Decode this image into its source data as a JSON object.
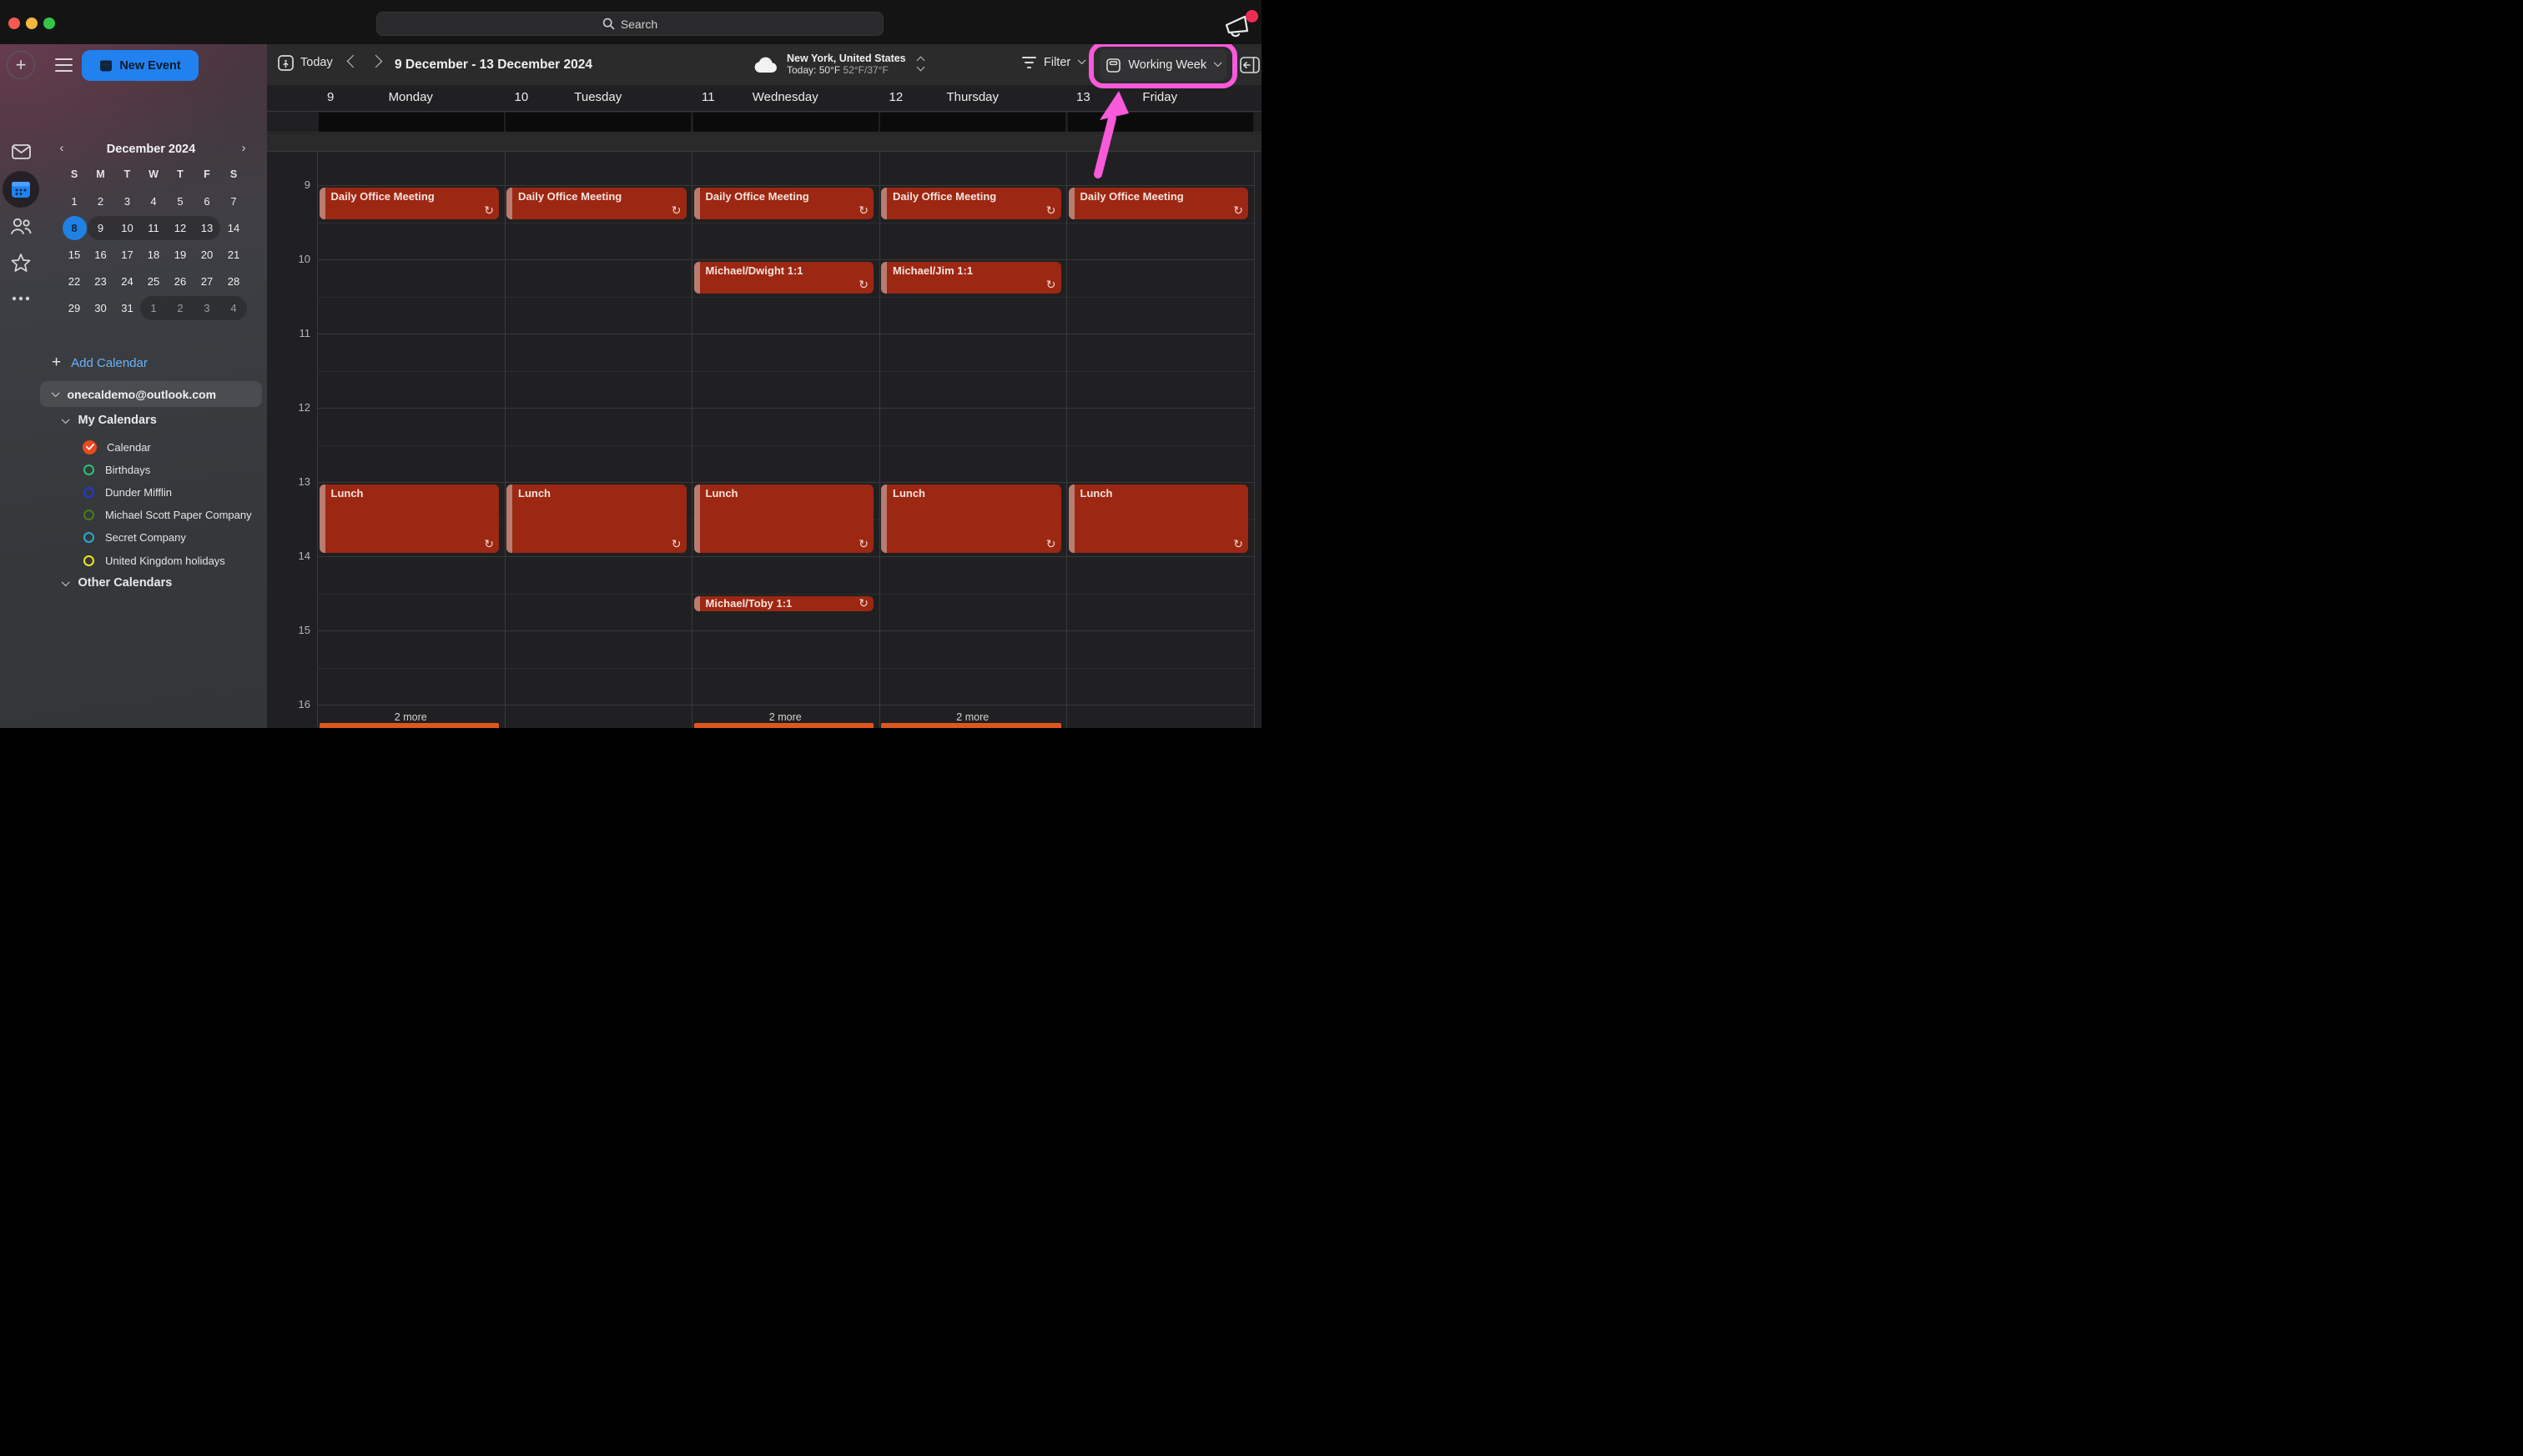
{
  "titlebar": {
    "search_placeholder": "Search"
  },
  "toolbar": {
    "new_event": "New Event",
    "today": "Today",
    "range_title": "9 December - 13 December 2024",
    "filter": "Filter",
    "view_mode": "Working Week"
  },
  "weather": {
    "location": "New York, United States",
    "today_label": "Today: 50°F",
    "hi_lo": "52°F/37°F"
  },
  "minicalendar": {
    "title": "December 2024",
    "weekdays": [
      "S",
      "M",
      "T",
      "W",
      "T",
      "F",
      "S"
    ],
    "weeks": [
      [
        {
          "d": "1"
        },
        {
          "d": "2"
        },
        {
          "d": "3"
        },
        {
          "d": "4"
        },
        {
          "d": "5"
        },
        {
          "d": "6"
        },
        {
          "d": "7"
        }
      ],
      [
        {
          "d": "8",
          "selected": true
        },
        {
          "d": "9"
        },
        {
          "d": "10"
        },
        {
          "d": "11"
        },
        {
          "d": "12"
        },
        {
          "d": "13"
        },
        {
          "d": "14"
        }
      ],
      [
        {
          "d": "15"
        },
        {
          "d": "16"
        },
        {
          "d": "17"
        },
        {
          "d": "18"
        },
        {
          "d": "19"
        },
        {
          "d": "20"
        },
        {
          "d": "21"
        }
      ],
      [
        {
          "d": "22"
        },
        {
          "d": "23"
        },
        {
          "d": "24"
        },
        {
          "d": "25"
        },
        {
          "d": "26"
        },
        {
          "d": "27"
        },
        {
          "d": "28"
        }
      ],
      [
        {
          "d": "29"
        },
        {
          "d": "30"
        },
        {
          "d": "31"
        },
        {
          "d": "1",
          "muted": true
        },
        {
          "d": "2",
          "muted": true
        },
        {
          "d": "3",
          "muted": true
        },
        {
          "d": "4",
          "muted": true
        }
      ]
    ],
    "pills": [
      {
        "week": 1,
        "from": 1,
        "to": 5
      },
      {
        "week": 4,
        "from": 3,
        "to": 6
      }
    ]
  },
  "sidebar": {
    "add_calendar": "Add Calendar",
    "account": "onecaldemo@outlook.com",
    "my_calendars": "My Calendars",
    "other_calendars": "Other Calendars",
    "calendars": [
      {
        "name": "Calendar",
        "color": "#e8491f",
        "checked": true
      },
      {
        "name": "Birthdays",
        "color": "#2fc176",
        "checked": false
      },
      {
        "name": "Dunder Mifflin",
        "color": "#2538d2",
        "checked": false
      },
      {
        "name": "Michael Scott Paper Company",
        "color": "#4a7a1e",
        "checked": false
      },
      {
        "name": "Secret Company",
        "color": "#2ba8cf",
        "checked": false
      },
      {
        "name": "United Kingdom holidays",
        "color": "#f2e41c",
        "checked": false
      }
    ]
  },
  "calendar": {
    "hours": [
      "9",
      "10",
      "11",
      "12",
      "13",
      "14",
      "15",
      "16"
    ],
    "days": [
      {
        "num": "9",
        "name": "Monday",
        "more": "2 more",
        "overflow": true,
        "events": [
          {
            "title": "Daily Office Meeting",
            "start": 9,
            "end": 9.5,
            "recurring": true
          },
          {
            "title": "Lunch",
            "start": 13,
            "end": 14,
            "recurring": true
          }
        ]
      },
      {
        "num": "10",
        "name": "Tuesday",
        "more": "",
        "overflow": false,
        "events": [
          {
            "title": "Daily Office Meeting",
            "start": 9,
            "end": 9.5,
            "recurring": true
          },
          {
            "title": "Lunch",
            "start": 13,
            "end": 14,
            "recurring": true
          }
        ]
      },
      {
        "num": "11",
        "name": "Wednesday",
        "more": "2 more",
        "overflow": true,
        "events": [
          {
            "title": "Daily Office Meeting",
            "start": 9,
            "end": 9.5,
            "recurring": true
          },
          {
            "title": "Michael/Dwight 1:1",
            "start": 10,
            "end": 10.5,
            "recurring": true
          },
          {
            "title": "Lunch",
            "start": 13,
            "end": 14,
            "recurring": true
          },
          {
            "title": "Michael/Toby 1:1",
            "start": 14.5,
            "end": 14.75,
            "recurring": true,
            "compact": true
          }
        ]
      },
      {
        "num": "12",
        "name": "Thursday",
        "more": "2 more",
        "overflow": true,
        "events": [
          {
            "title": "Daily Office Meeting",
            "start": 9,
            "end": 9.5,
            "recurring": true
          },
          {
            "title": "Michael/Jim 1:1",
            "start": 10,
            "end": 10.5,
            "recurring": true
          },
          {
            "title": "Lunch",
            "start": 13,
            "end": 14,
            "recurring": true
          }
        ]
      },
      {
        "num": "13",
        "name": "Friday",
        "more": "",
        "overflow": false,
        "events": [
          {
            "title": "Daily Office Meeting",
            "start": 9,
            "end": 9.5,
            "recurring": true
          },
          {
            "title": "Lunch",
            "start": 13,
            "end": 14,
            "recurring": true
          }
        ]
      }
    ]
  },
  "colors": {
    "accent_blue": "#2181ee",
    "event_red": "#9c2713",
    "event_strip": "#b97c71",
    "overflow_orange": "#df5620",
    "highlight_pink": "#f85ad9",
    "selected_day_blue": "#2081e4",
    "notification_dot": "#ee2d55"
  },
  "icons": {
    "recurrence": "↻",
    "plus": "+",
    "search": "search-icon",
    "megaphone": "announcement-icon"
  }
}
